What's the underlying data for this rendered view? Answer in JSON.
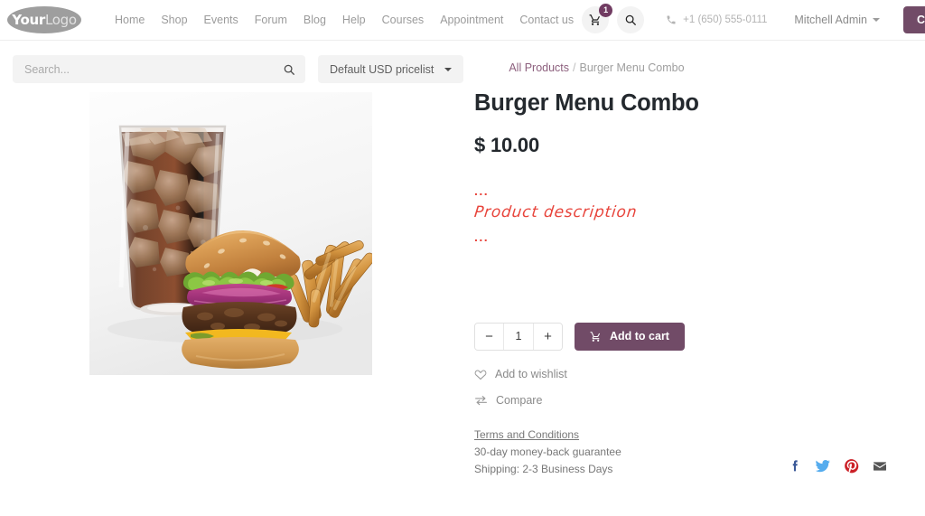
{
  "header": {
    "logo": {
      "text_primary": "Your",
      "text_secondary": "Logo",
      "name": "YourLogo"
    },
    "nav": [
      {
        "label": "Home"
      },
      {
        "label": "Shop"
      },
      {
        "label": "Events"
      },
      {
        "label": "Forum"
      },
      {
        "label": "Blog"
      },
      {
        "label": "Help"
      },
      {
        "label": "Courses"
      },
      {
        "label": "Appointment"
      },
      {
        "label": "Contact us"
      }
    ],
    "cart": {
      "icon": "shopping-cart-icon",
      "badge_count": "1"
    },
    "search_icon": "search-icon",
    "phone": {
      "icon": "phone-icon",
      "number": "+1 (650) 555-0111"
    },
    "user": {
      "name": "Mitchell Admin",
      "caret": "chevron-down-icon"
    },
    "contact_button": {
      "label": "Contact Us"
    }
  },
  "toolbar": {
    "search": {
      "placeholder": "Search...",
      "value": "",
      "icon": "search-icon"
    },
    "pricelist": {
      "label": "Default USD pricelist",
      "caret": "chevron-down-icon"
    }
  },
  "breadcrumb": {
    "parent": "All Products",
    "separator": "/",
    "current": "Burger Menu Combo"
  },
  "product": {
    "image_alt": "Burger Menu Combo: cola glass with ice, cheeseburger with lettuce and red onion, and french fries",
    "title": "Burger Menu Combo",
    "price": "$ 10.00",
    "description": {
      "dots_top": "...",
      "text": "Product description",
      "dots_bottom": "..."
    },
    "quantity": {
      "decrement_label": "−",
      "value": "1",
      "increment_label": "+"
    },
    "add_to_cart": {
      "label": "Add to cart",
      "icon": "shopping-cart-icon"
    },
    "wishlist": {
      "label": "Add to wishlist",
      "icon": "heart-icon"
    },
    "compare": {
      "label": "Compare",
      "icon": "compare-arrows-icon"
    },
    "terms": {
      "link_label": "Terms and Conditions",
      "guarantee": "30-day money-back guarantee",
      "shipping": "Shipping: 2-3 Business Days"
    }
  },
  "socials": [
    {
      "name": "facebook-icon",
      "color": "#3b5998"
    },
    {
      "name": "twitter-icon",
      "color": "#55acee"
    },
    {
      "name": "pinterest-icon",
      "color": "#cb2027"
    },
    {
      "name": "email-icon",
      "color": "#555555"
    }
  ],
  "colors": {
    "brand_plum": "#714b67",
    "badge_plum": "#713c62",
    "link_plum": "#8c5f7d",
    "annotation_red": "#e8453c",
    "muted_text": "#9b9b9b"
  }
}
